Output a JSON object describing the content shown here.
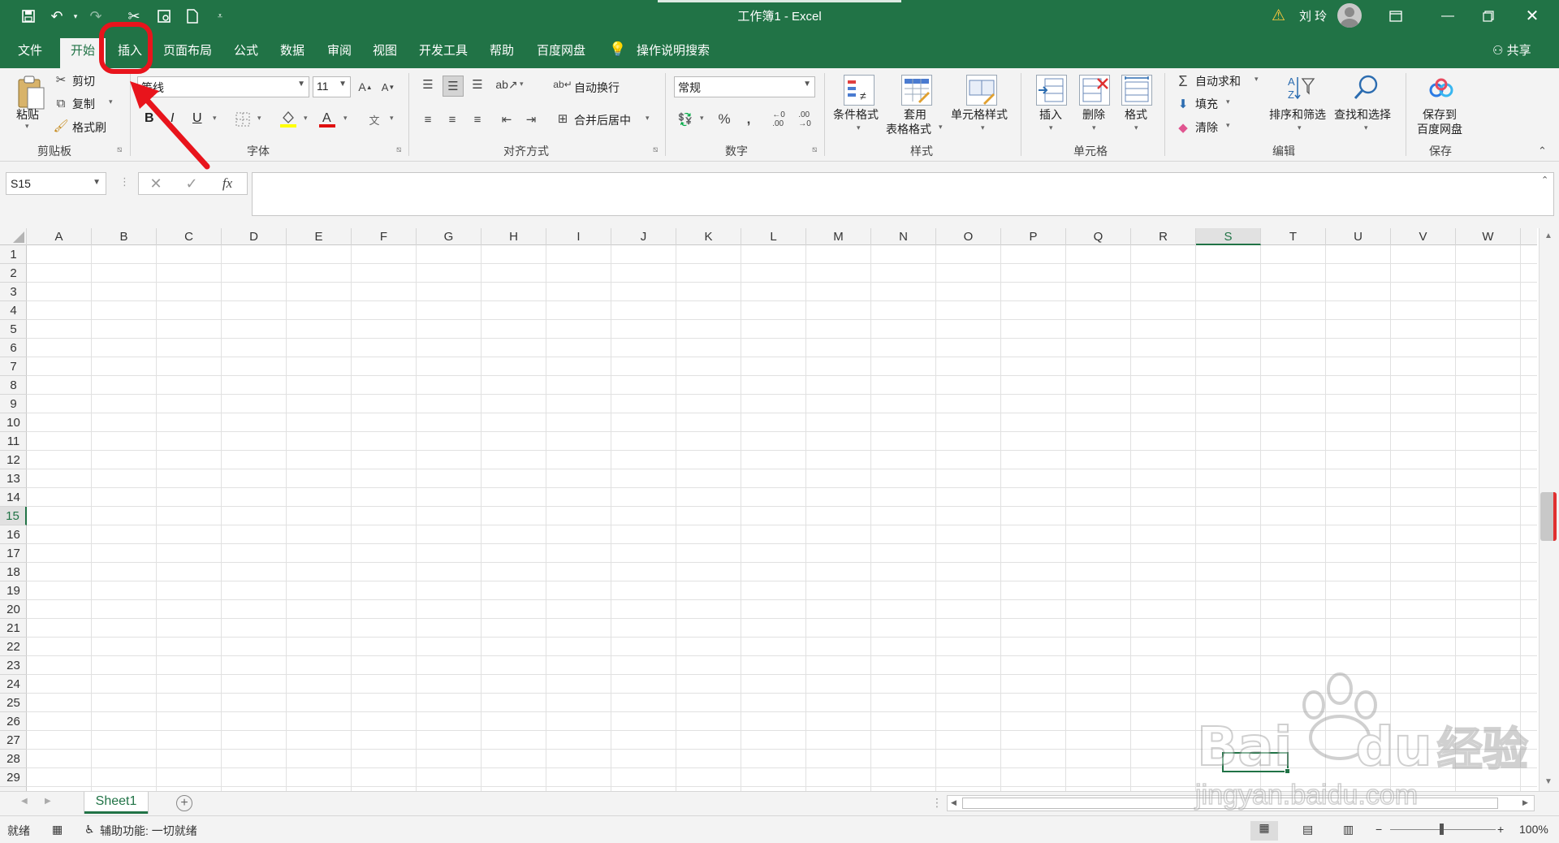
{
  "titlebar": {
    "title": "工作簿1  -  Excel",
    "user": "刘 玲",
    "icons": [
      "save-icon",
      "undo-icon",
      "redo-icon",
      "cut-icon",
      "print-preview-icon",
      "new-doc-icon",
      "customize-qat-icon"
    ]
  },
  "tabs": {
    "file": "文件",
    "home": "开始",
    "insert": "插入",
    "layout": "页面布局",
    "formulas": "公式",
    "data": "数据",
    "review": "审阅",
    "view": "视图",
    "developer": "开发工具",
    "help": "帮助",
    "baidu": "百度网盘",
    "tell_me": "操作说明搜索",
    "share": "共享"
  },
  "ribbon": {
    "clipboard": {
      "paste": "粘贴",
      "cut": "剪切",
      "copy": "复制",
      "format_painter": "格式刷",
      "label": "剪贴板"
    },
    "font": {
      "name": "等线",
      "size": "11",
      "bold": "B",
      "italic": "I",
      "underline": "U",
      "label": "字体"
    },
    "alignment": {
      "wrap": "自动换行",
      "merge": "合并后居中",
      "label": "对齐方式"
    },
    "number": {
      "format": "常规",
      "label": "数字"
    },
    "styles": {
      "conditional": "条件格式",
      "as_table_1": "套用",
      "as_table_2": "表格格式",
      "cell_styles": "单元格样式",
      "label": "样式"
    },
    "cells": {
      "insert": "插入",
      "delete": "删除",
      "format": "格式",
      "label": "单元格"
    },
    "editing": {
      "autosum": "自动求和",
      "fill": "填充",
      "clear": "清除",
      "sort": "排序和筛选",
      "find": "查找和选择",
      "label": "编辑"
    },
    "save": {
      "line1": "保存到",
      "line2": "百度网盘",
      "label": "保存"
    }
  },
  "formula_bar": {
    "name_box": "S15",
    "fx": "fx",
    "value": ""
  },
  "grid": {
    "columns": [
      "A",
      "B",
      "C",
      "D",
      "E",
      "F",
      "G",
      "H",
      "I",
      "J",
      "K",
      "L",
      "M",
      "N",
      "O",
      "P",
      "Q",
      "R",
      "S",
      "T",
      "U",
      "V",
      "W"
    ],
    "rows": [
      "1",
      "2",
      "3",
      "4",
      "5",
      "6",
      "7",
      "8",
      "9",
      "10",
      "11",
      "12",
      "13",
      "14",
      "15",
      "16",
      "17",
      "18",
      "19",
      "20",
      "21",
      "22",
      "23",
      "24",
      "25",
      "26",
      "27",
      "28",
      "29"
    ],
    "active_column": "S",
    "active_row": "15"
  },
  "sheets": {
    "tabs": [
      "Sheet1"
    ],
    "active": "Sheet1"
  },
  "status": {
    "ready": "就绪",
    "accessibility": "辅助功能: 一切就绪",
    "zoom": "100%"
  },
  "watermark": {
    "brand": "Bai",
    "brand2": "du",
    "cn": "经验",
    "url": "jingyan.baidu.com"
  },
  "colors": {
    "accent": "#217346",
    "annotation": "#e8141c"
  }
}
